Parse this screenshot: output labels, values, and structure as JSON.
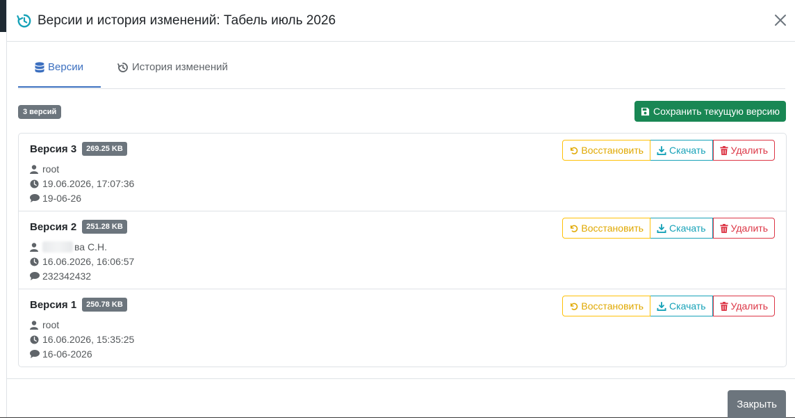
{
  "modal": {
    "title": "Версии и история изменений: Табель июль 2026",
    "close_label": "Закрыть"
  },
  "tabs": [
    {
      "label": "Версии",
      "icon": "database-icon",
      "active": true
    },
    {
      "label": "История изменений",
      "icon": "history-icon",
      "active": false
    }
  ],
  "versions_count": "3 версий",
  "save_button": "Сохранить текущую версию",
  "buttons": {
    "restore": "Восстановить",
    "download": "Скачать",
    "delete": "Удалить"
  },
  "versions": [
    {
      "name": "Версия 3",
      "size": "269.25 KB",
      "user": "root",
      "datetime": "19.06.2026, 17:07:36",
      "comment": "19-06-26"
    },
    {
      "name": "Версия 2",
      "size": "251.28 KB",
      "user": "ва С.Н.",
      "datetime": "16.06.2026, 16:06:57",
      "comment": "232342432"
    },
    {
      "name": "Версия 1",
      "size": "250.78 KB",
      "user": "root",
      "datetime": "16.06.2026, 15:35:25",
      "comment": "16-06-2026"
    }
  ],
  "colors": {
    "primary": "#3b6fbf",
    "success": "#198754",
    "warning": "#ffc107",
    "info": "#17a2b8",
    "danger": "#dc3545",
    "secondary": "#6c757d"
  }
}
